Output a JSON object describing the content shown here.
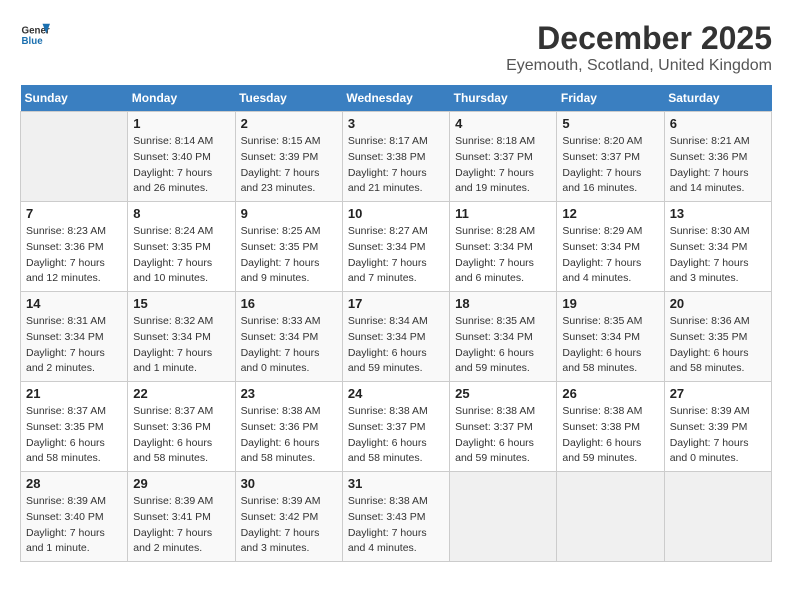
{
  "header": {
    "logo_general": "General",
    "logo_blue": "Blue",
    "month": "December 2025",
    "location": "Eyemouth, Scotland, United Kingdom"
  },
  "days_of_week": [
    "Sunday",
    "Monday",
    "Tuesday",
    "Wednesday",
    "Thursday",
    "Friday",
    "Saturday"
  ],
  "weeks": [
    [
      {
        "day": "",
        "info": ""
      },
      {
        "day": "1",
        "info": "Sunrise: 8:14 AM\nSunset: 3:40 PM\nDaylight: 7 hours\nand 26 minutes."
      },
      {
        "day": "2",
        "info": "Sunrise: 8:15 AM\nSunset: 3:39 PM\nDaylight: 7 hours\nand 23 minutes."
      },
      {
        "day": "3",
        "info": "Sunrise: 8:17 AM\nSunset: 3:38 PM\nDaylight: 7 hours\nand 21 minutes."
      },
      {
        "day": "4",
        "info": "Sunrise: 8:18 AM\nSunset: 3:37 PM\nDaylight: 7 hours\nand 19 minutes."
      },
      {
        "day": "5",
        "info": "Sunrise: 8:20 AM\nSunset: 3:37 PM\nDaylight: 7 hours\nand 16 minutes."
      },
      {
        "day": "6",
        "info": "Sunrise: 8:21 AM\nSunset: 3:36 PM\nDaylight: 7 hours\nand 14 minutes."
      }
    ],
    [
      {
        "day": "7",
        "info": "Sunrise: 8:23 AM\nSunset: 3:36 PM\nDaylight: 7 hours\nand 12 minutes."
      },
      {
        "day": "8",
        "info": "Sunrise: 8:24 AM\nSunset: 3:35 PM\nDaylight: 7 hours\nand 10 minutes."
      },
      {
        "day": "9",
        "info": "Sunrise: 8:25 AM\nSunset: 3:35 PM\nDaylight: 7 hours\nand 9 minutes."
      },
      {
        "day": "10",
        "info": "Sunrise: 8:27 AM\nSunset: 3:34 PM\nDaylight: 7 hours\nand 7 minutes."
      },
      {
        "day": "11",
        "info": "Sunrise: 8:28 AM\nSunset: 3:34 PM\nDaylight: 7 hours\nand 6 minutes."
      },
      {
        "day": "12",
        "info": "Sunrise: 8:29 AM\nSunset: 3:34 PM\nDaylight: 7 hours\nand 4 minutes."
      },
      {
        "day": "13",
        "info": "Sunrise: 8:30 AM\nSunset: 3:34 PM\nDaylight: 7 hours\nand 3 minutes."
      }
    ],
    [
      {
        "day": "14",
        "info": "Sunrise: 8:31 AM\nSunset: 3:34 PM\nDaylight: 7 hours\nand 2 minutes."
      },
      {
        "day": "15",
        "info": "Sunrise: 8:32 AM\nSunset: 3:34 PM\nDaylight: 7 hours\nand 1 minute."
      },
      {
        "day": "16",
        "info": "Sunrise: 8:33 AM\nSunset: 3:34 PM\nDaylight: 7 hours\nand 0 minutes."
      },
      {
        "day": "17",
        "info": "Sunrise: 8:34 AM\nSunset: 3:34 PM\nDaylight: 6 hours\nand 59 minutes."
      },
      {
        "day": "18",
        "info": "Sunrise: 8:35 AM\nSunset: 3:34 PM\nDaylight: 6 hours\nand 59 minutes."
      },
      {
        "day": "19",
        "info": "Sunrise: 8:35 AM\nSunset: 3:34 PM\nDaylight: 6 hours\nand 58 minutes."
      },
      {
        "day": "20",
        "info": "Sunrise: 8:36 AM\nSunset: 3:35 PM\nDaylight: 6 hours\nand 58 minutes."
      }
    ],
    [
      {
        "day": "21",
        "info": "Sunrise: 8:37 AM\nSunset: 3:35 PM\nDaylight: 6 hours\nand 58 minutes."
      },
      {
        "day": "22",
        "info": "Sunrise: 8:37 AM\nSunset: 3:36 PM\nDaylight: 6 hours\nand 58 minutes."
      },
      {
        "day": "23",
        "info": "Sunrise: 8:38 AM\nSunset: 3:36 PM\nDaylight: 6 hours\nand 58 minutes."
      },
      {
        "day": "24",
        "info": "Sunrise: 8:38 AM\nSunset: 3:37 PM\nDaylight: 6 hours\nand 58 minutes."
      },
      {
        "day": "25",
        "info": "Sunrise: 8:38 AM\nSunset: 3:37 PM\nDaylight: 6 hours\nand 59 minutes."
      },
      {
        "day": "26",
        "info": "Sunrise: 8:38 AM\nSunset: 3:38 PM\nDaylight: 6 hours\nand 59 minutes."
      },
      {
        "day": "27",
        "info": "Sunrise: 8:39 AM\nSunset: 3:39 PM\nDaylight: 7 hours\nand 0 minutes."
      }
    ],
    [
      {
        "day": "28",
        "info": "Sunrise: 8:39 AM\nSunset: 3:40 PM\nDaylight: 7 hours\nand 1 minute."
      },
      {
        "day": "29",
        "info": "Sunrise: 8:39 AM\nSunset: 3:41 PM\nDaylight: 7 hours\nand 2 minutes."
      },
      {
        "day": "30",
        "info": "Sunrise: 8:39 AM\nSunset: 3:42 PM\nDaylight: 7 hours\nand 3 minutes."
      },
      {
        "day": "31",
        "info": "Sunrise: 8:38 AM\nSunset: 3:43 PM\nDaylight: 7 hours\nand 4 minutes."
      },
      {
        "day": "",
        "info": ""
      },
      {
        "day": "",
        "info": ""
      },
      {
        "day": "",
        "info": ""
      }
    ]
  ]
}
